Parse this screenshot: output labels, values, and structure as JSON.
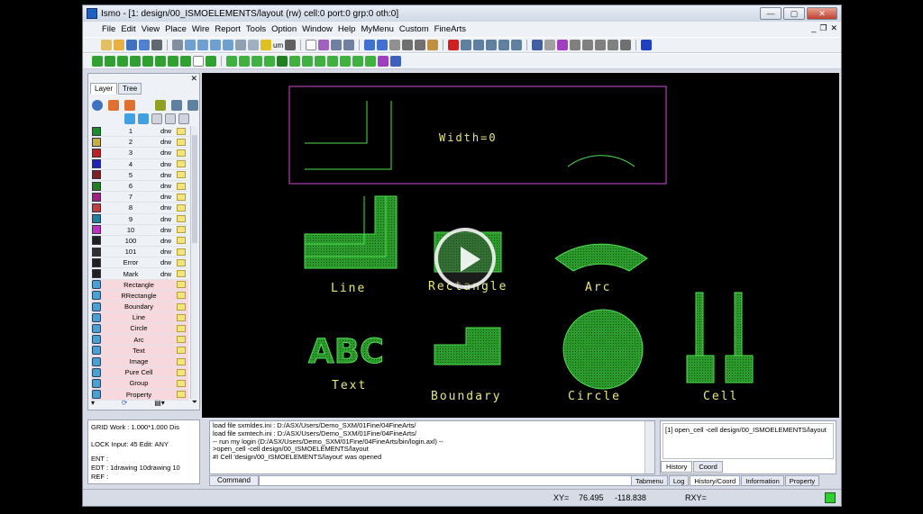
{
  "window": {
    "title": "Ismo - [1: design/00_ISMOELEMENTS/layout (rw) cell:0 port:0 grp:0 oth:0]",
    "controls": [
      "—",
      "▢",
      "✕"
    ]
  },
  "menu": {
    "items": [
      "File",
      "Edit",
      "View",
      "Place",
      "Wire",
      "Report",
      "Tools",
      "Option",
      "Window",
      "Help",
      "MyMenu",
      "Custom",
      "FineArts"
    ],
    "mdi_controls": [
      "_",
      "❐",
      "✕"
    ]
  },
  "toolbar": {
    "unit_label": "um"
  },
  "left_panel": {
    "tabs": [
      "Layer",
      "Tree"
    ],
    "close_label": "✕",
    "layers": [
      {
        "name": "1",
        "type": "drw",
        "color": "#1a8c2a"
      },
      {
        "name": "2",
        "type": "drw",
        "color": "#c8b040"
      },
      {
        "name": "3",
        "type": "drw",
        "color": "#c02020"
      },
      {
        "name": "4",
        "type": "drw",
        "color": "#2020c0"
      },
      {
        "name": "5",
        "type": "drw",
        "color": "#802020"
      },
      {
        "name": "6",
        "type": "drw",
        "color": "#208020"
      },
      {
        "name": "7",
        "type": "drw",
        "color": "#a02080"
      },
      {
        "name": "8",
        "type": "drw",
        "color": "#c04040"
      },
      {
        "name": "9",
        "type": "drw",
        "color": "#2080a0"
      },
      {
        "name": "10",
        "type": "drw",
        "color": "#c030c0"
      },
      {
        "name": "100",
        "type": "drw",
        "color": "#202020"
      },
      {
        "name": "101",
        "type": "drw",
        "color": "#303030"
      },
      {
        "name": "Error",
        "type": "drw",
        "color": "#202020"
      },
      {
        "name": "Mark",
        "type": "drw",
        "color": "#202020"
      }
    ],
    "objects": [
      {
        "name": "Rectangle"
      },
      {
        "name": "RRectangle"
      },
      {
        "name": "Boundary"
      },
      {
        "name": "Line"
      },
      {
        "name": "Circle"
      },
      {
        "name": "Arc"
      },
      {
        "name": "Text"
      },
      {
        "name": "Image"
      },
      {
        "name": "Pure Cell"
      },
      {
        "name": "Group"
      },
      {
        "name": "Property"
      }
    ]
  },
  "canvas": {
    "width_label": "Width=0",
    "labels": {
      "line": "Line",
      "rectangle": "Rectangle",
      "arc": "Arc",
      "text": "Text",
      "boundary": "Boundary",
      "circle": "Circle",
      "cell": "Cell",
      "abc": "ABC"
    },
    "colors": {
      "shape_fill": "#2a9a2a",
      "shape_stroke": "#50e050",
      "frame": "#b040b0",
      "label": "#e8e878"
    }
  },
  "status_panel": {
    "lines": [
      "GRID  Work : 1.000*1.000  Dis",
      "LOCK  Input: 45  Edit: ANY",
      "ENT :",
      "EDT : 1drawing 10drawing 10",
      "REF :"
    ]
  },
  "log": {
    "lines": [
      "load file sxmldes.ini : D:/ASX/Users/Demo_SXM/01Fine/04FineArts/",
      "load file sxmtech.ini : D:/ASX/Users/Demo_SXM/01Fine/04FineArts/",
      "-- run my login (D:/ASX/Users/Demo_SXM/01Fine/04FineArts/bin/login.axl) --",
      ">open_cell -cell design/00_ISMOELEMENTS/layout",
      "#I Cell 'design/00_ISMOELEMENTS/layout' was opened"
    ],
    "command_label": "Command"
  },
  "history": {
    "line": "[1] open_cell -cell design/00_ISMOELEMENTS/layout",
    "tabs": [
      "History",
      "Coord"
    ]
  },
  "bottom_tabs": [
    "Tabmenu",
    "Log",
    "History/Coord",
    "Information",
    "Property"
  ],
  "statusbar": {
    "xy_label": "XY=",
    "x": "76.495",
    "y": "-118.838",
    "rxy_label": "RXY="
  }
}
